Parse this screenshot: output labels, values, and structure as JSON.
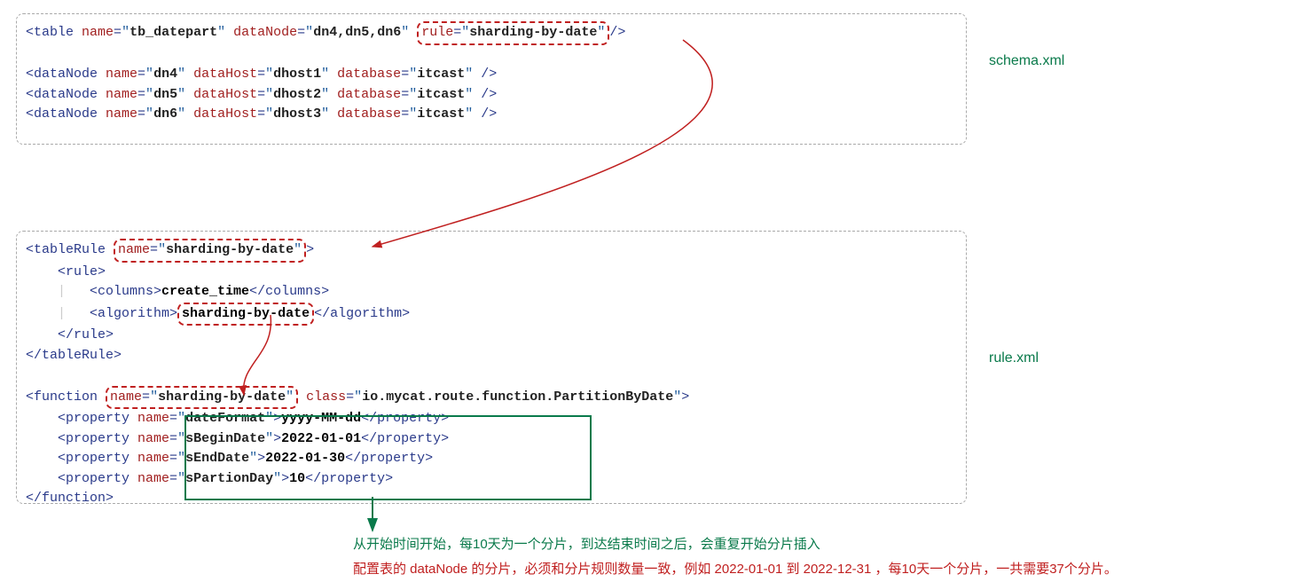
{
  "files": {
    "schema": "schema.xml",
    "rule": "rule.xml"
  },
  "schema": {
    "table": {
      "name": "tb_datepart",
      "dataNode": "dn4,dn5,dn6",
      "ruleAttr": "rule",
      "ruleVal": "sharding-by-date"
    },
    "nodes": [
      {
        "name": "dn4",
        "host": "dhost1",
        "db": "itcast"
      },
      {
        "name": "dn5",
        "host": "dhost2",
        "db": "itcast"
      },
      {
        "name": "dn6",
        "host": "dhost3",
        "db": "itcast"
      }
    ]
  },
  "rule": {
    "tableRuleName": "sharding-by-date",
    "column": "create_time",
    "algorithm": "sharding-by-date",
    "functionName": "sharding-by-date",
    "functionClass": "io.mycat.route.function.PartitionByDate",
    "props": [
      {
        "name": "dateFormat",
        "val": "yyyy-MM-dd"
      },
      {
        "name": "sBeginDate",
        "val": "2022-01-01"
      },
      {
        "name": "sEndDate",
        "val": "2022-01-30"
      },
      {
        "name": "sPartionDay",
        "val": "10"
      }
    ]
  },
  "notes": {
    "green": "从开始时间开始，每10天为一个分片，到达结束时间之后，会重复开始分片插入",
    "red": "配置表的 dataNode 的分片，必须和分片规则数量一致，例如 2022-01-01 到 2022-12-31 ，每10天一个分片，一共需要37个分片。"
  }
}
